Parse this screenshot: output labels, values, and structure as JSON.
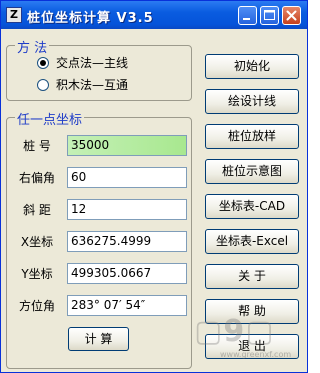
{
  "window": {
    "title": "桩位坐标计算 V3.5",
    "icon_letter": "Z"
  },
  "method": {
    "legend": "方 法",
    "options": [
      {
        "label": "交点法—主线",
        "selected": true
      },
      {
        "label": "积木法—互通",
        "selected": false
      }
    ]
  },
  "point": {
    "legend": "任一点坐标",
    "fields": [
      {
        "label": "桩 号",
        "value": "35000"
      },
      {
        "label": "右偏角",
        "value": "60"
      },
      {
        "label": "斜 距",
        "value": "12"
      },
      {
        "label": "X坐标",
        "value": "636275.4999"
      },
      {
        "label": "Y坐标",
        "value": "499305.0667"
      },
      {
        "label": "方位角",
        "value": "283° 07′ 54″"
      }
    ],
    "calc_button": "计 算"
  },
  "buttons": [
    "初始化",
    "绘设计线",
    "桩位放样",
    "桩位示意图",
    "坐标表-CAD",
    "坐标表-Excel",
    "关 于",
    "帮 助",
    "退 出"
  ],
  "watermark": {
    "text": "▢9▢",
    "sub": "www.greenxf.com"
  },
  "colors": {
    "titlebar": "#0553d9",
    "legend": "#1e3cc8",
    "face": "#ece9d8",
    "selected_field": "#a8e88f"
  }
}
